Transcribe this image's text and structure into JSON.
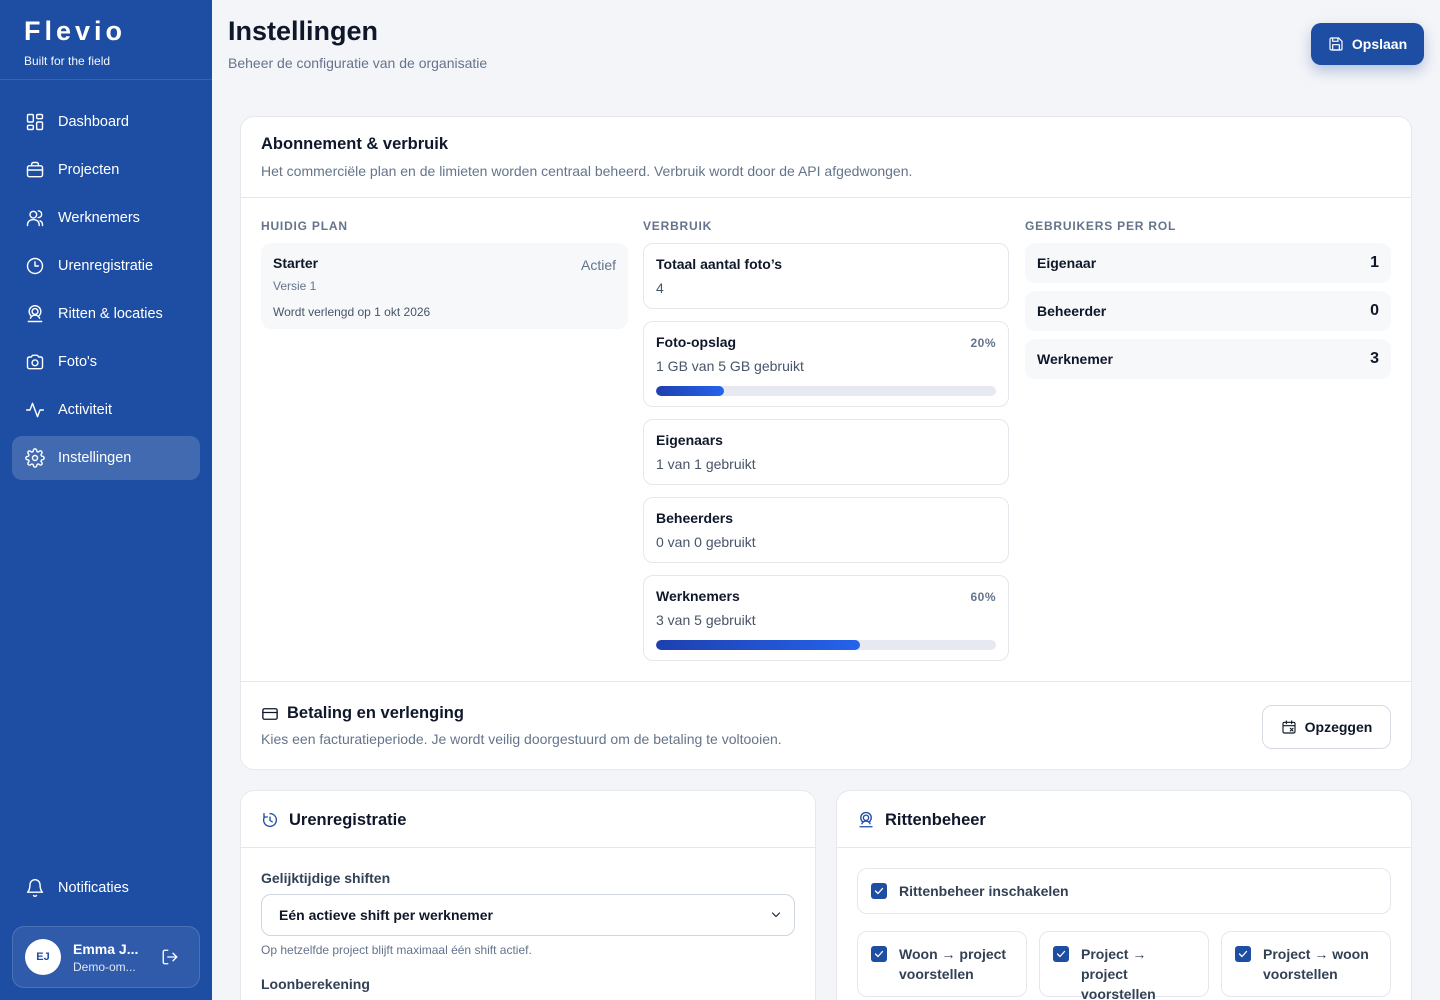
{
  "brand": {
    "name": "Flevio",
    "tagline": "Built for the field"
  },
  "nav": {
    "items": [
      {
        "label": "Dashboard",
        "icon": "grid-icon"
      },
      {
        "label": "Projecten",
        "icon": "briefcase-icon"
      },
      {
        "label": "Werknemers",
        "icon": "users-icon"
      },
      {
        "label": "Urenregistratie",
        "icon": "clock-icon"
      },
      {
        "label": "Ritten & locaties",
        "icon": "map-pin-user-icon"
      },
      {
        "label": "Foto's",
        "icon": "camera-icon"
      },
      {
        "label": "Activiteit",
        "icon": "activity-icon"
      },
      {
        "label": "Instellingen",
        "icon": "gear-icon",
        "active": true
      }
    ],
    "notifications": "Notificaties"
  },
  "user": {
    "initials": "EJ",
    "name": "Emma J...",
    "org": "Demo-om..."
  },
  "header": {
    "title": "Instellingen",
    "subtitle": "Beheer de configuratie van de organisatie",
    "save_label": "Opslaan"
  },
  "subscription": {
    "title": "Abonnement & verbruik",
    "description": "Het commerciële plan en de limieten worden centraal beheerd. Verbruik wordt door de API afgedwongen.",
    "plan_label": "HUIDIG PLAN",
    "usage_label": "VERBRUIK",
    "roles_label": "GEBRUIKERS PER ROL",
    "plan": {
      "name": "Starter",
      "status": "Actief",
      "version": "Versie 1",
      "renewal": "Wordt verlengd op 1 okt 2026"
    },
    "usage": [
      {
        "title": "Totaal aantal foto’s",
        "value": "4"
      },
      {
        "title": "Foto-opslag",
        "value": "1 GB van 5 GB gebruikt",
        "percent_label": "20%",
        "progress": 0.2
      },
      {
        "title": "Eigenaars",
        "value": "1 van 1 gebruikt"
      },
      {
        "title": "Beheerders",
        "value": "0 van 0 gebruikt"
      },
      {
        "title": "Werknemers",
        "value": "3 van 5 gebruikt",
        "percent_label": "60%",
        "progress": 0.6
      }
    ],
    "roles": [
      {
        "name": "Eigenaar",
        "count": "1"
      },
      {
        "name": "Beheerder",
        "count": "0"
      },
      {
        "name": "Werknemer",
        "count": "3"
      }
    ]
  },
  "payment": {
    "title": "Betaling en verlenging",
    "description": "Kies een facturatieperiode. Je wordt veilig doorgestuurd om de betaling te voltooien.",
    "cancel_label": "Opzeggen"
  },
  "time_tracking": {
    "title": "Urenregistratie",
    "shifts_label": "Gelijktijdige shiften",
    "shifts_value": "Eén actieve shift per werknemer",
    "shifts_help": "Op hetzelfde project blijft maximaal één shift actief.",
    "wage_label": "Loonberekening"
  },
  "trips": {
    "title": "Rittenbeheer",
    "enable_label": "Rittenbeheer inschakelen",
    "enabled": true,
    "options": [
      {
        "line1": "Woon → project",
        "line2": "voorstellen",
        "checked": true
      },
      {
        "line1": "Project → project",
        "line2": "voorstellen",
        "checked": true
      },
      {
        "line1": "Project → woon",
        "line2": "voorstellen",
        "checked": true
      }
    ]
  },
  "colors": {
    "primary": "#1e4ea3",
    "accent": "#2563eb",
    "muted": "#64748b"
  }
}
